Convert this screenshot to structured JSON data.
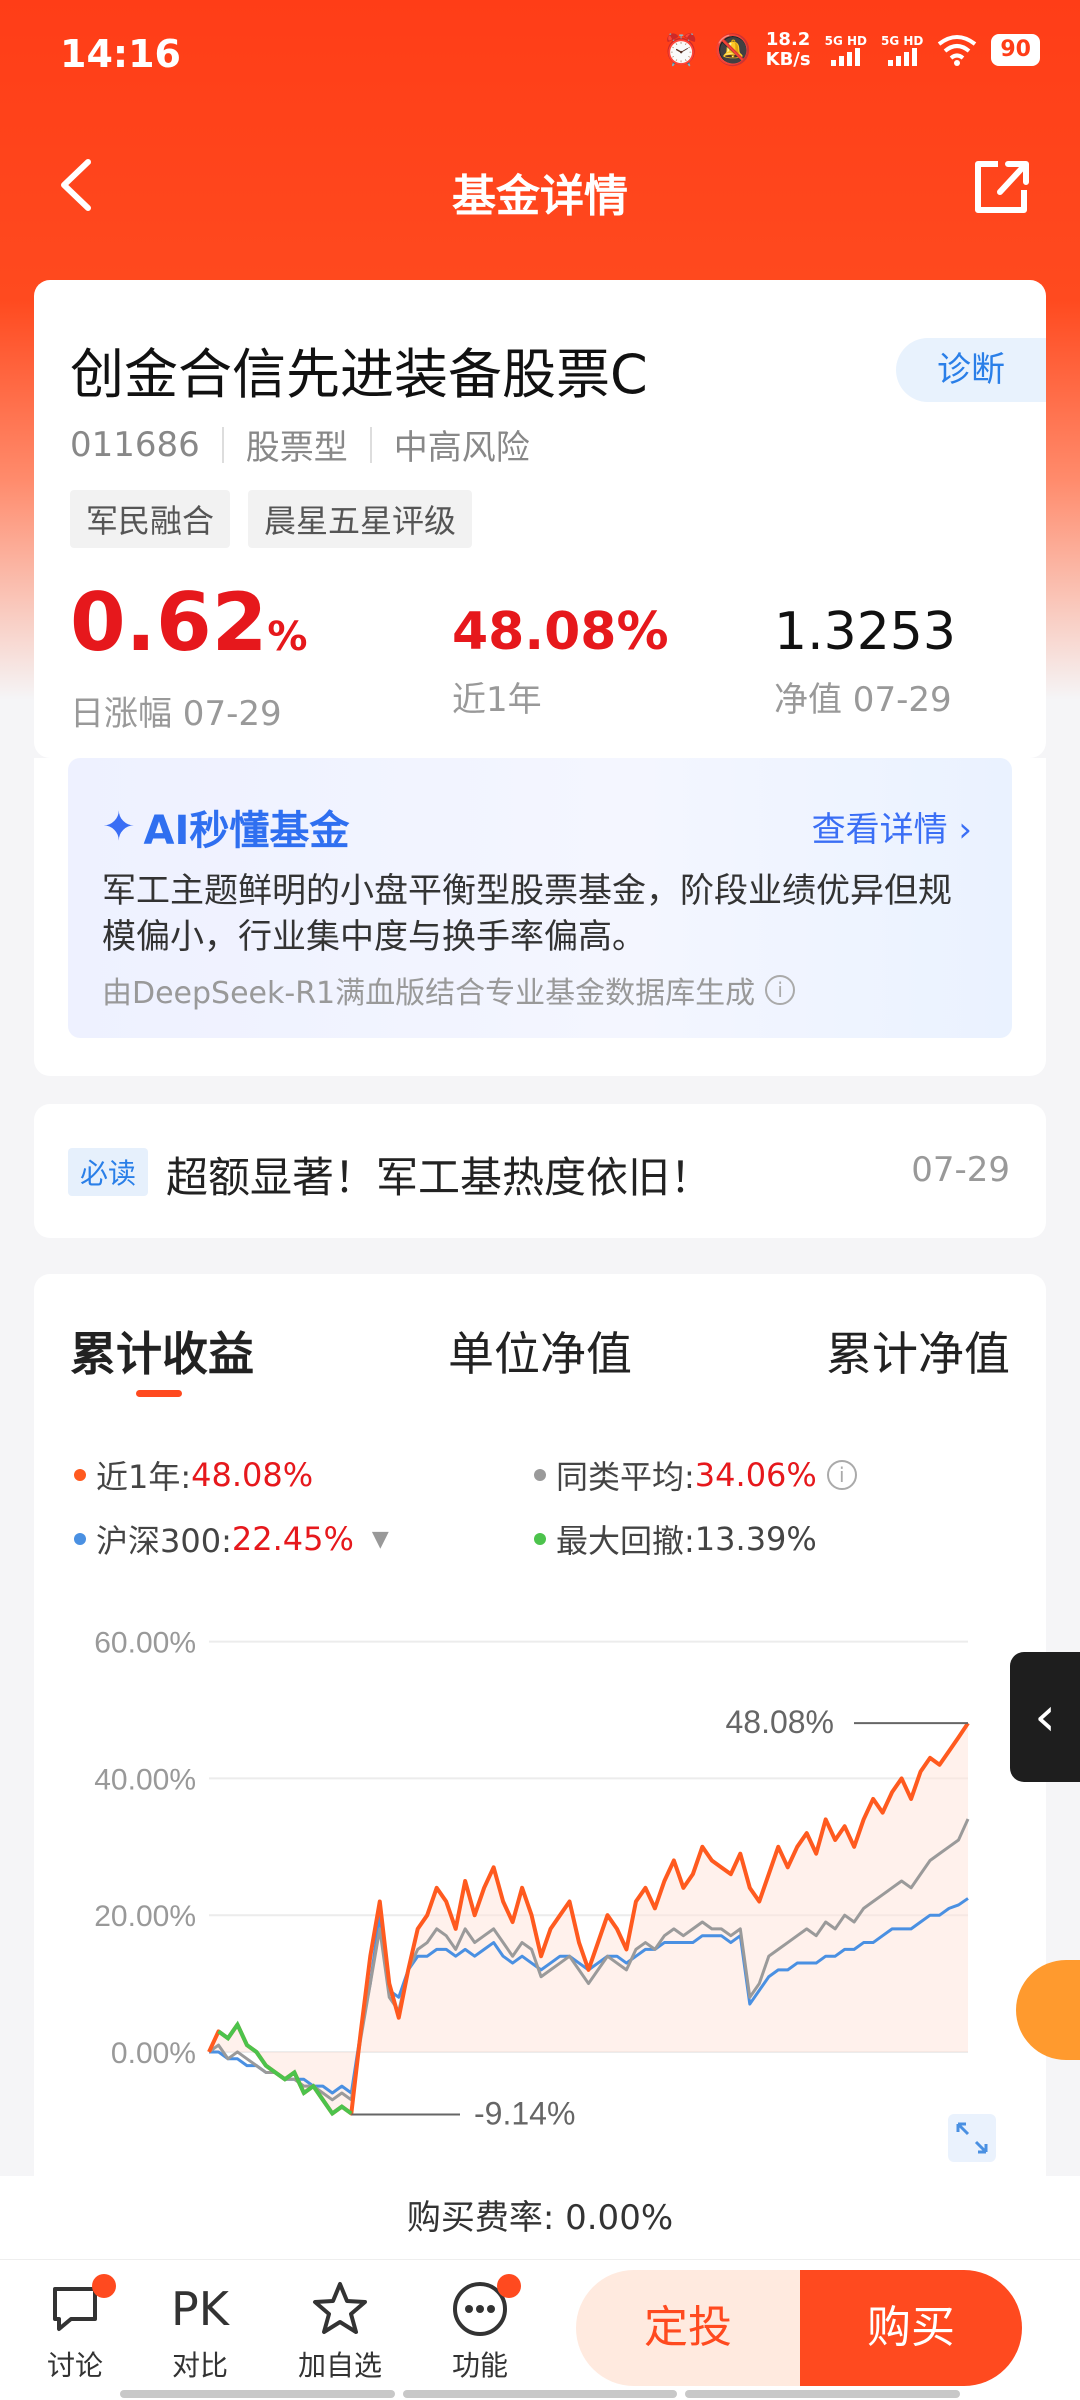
{
  "status_bar": {
    "time": "14:16",
    "net_speed_value": "18.2",
    "net_speed_unit": "KB/s",
    "signal1": "5G HD",
    "signal2": "5G HD",
    "battery": "90"
  },
  "nav": {
    "title": "基金详情"
  },
  "fund": {
    "name": "创金合信先进装备股票C",
    "diagnose_label": "诊断",
    "code": "011686",
    "type": "股票型",
    "risk": "中高风险",
    "tags": [
      "军民融合",
      "晨星五星评级"
    ],
    "daily_change_value": "0.62",
    "daily_change_unit": "%",
    "daily_change_label": "日涨幅 07-29",
    "year_return": "48.08%",
    "year_return_label": "近1年",
    "nav_value": "1.3253",
    "nav_label": "净值 07-29"
  },
  "ai": {
    "title": "AI秒懂基金",
    "more": "查看详情",
    "summary": "军工主题鲜明的小盘平衡型股票基金，阶段业绩优异但规模偏小，行业集中度与换手率偏高。",
    "source": "由DeepSeek-R1满血版结合专业基金数据库生成"
  },
  "news": {
    "tag": "必读",
    "title": "超额显著！军工基热度依旧！",
    "date": "07-29"
  },
  "chart_tabs": [
    "累计收益",
    "单位净值",
    "累计净值"
  ],
  "legend": {
    "fund_label": "近1年:",
    "fund_value": "48.08%",
    "avg_label": "同类平均:",
    "avg_value": "34.06%",
    "hs300_label": "沪深300:",
    "hs300_value": "22.45%",
    "drawdown_label": "最大回撤:",
    "drawdown_value": "13.39%"
  },
  "colors": {
    "fund": "#ff5a1f",
    "average": "#9a9a9a",
    "hs300": "#4a90e2",
    "drawdown": "#4cc34c"
  },
  "chart_data": {
    "type": "line",
    "y_ticks": [
      "60.00%",
      "40.00%",
      "20.00%",
      "0.00%"
    ],
    "ylim": [
      -12,
      62
    ],
    "annotations": {
      "max_label": "48.08%",
      "min_label": "-9.14%"
    },
    "x": [
      0,
      1,
      2,
      3,
      4,
      5,
      6,
      7,
      8,
      9,
      10,
      11,
      12,
      13,
      14,
      15,
      16,
      17,
      18,
      19,
      20,
      21,
      22,
      23,
      24,
      25,
      26,
      27,
      28,
      29,
      30,
      31,
      32,
      33,
      34,
      35,
      36,
      37,
      38,
      39,
      40,
      41,
      42,
      43,
      44,
      45,
      46,
      47,
      48,
      49,
      50,
      51,
      52,
      53,
      54,
      55,
      56,
      57,
      58,
      59,
      60,
      61,
      62,
      63,
      64,
      65,
      66,
      67,
      68,
      69,
      70,
      71,
      72,
      73,
      74,
      75,
      76,
      77,
      78,
      79,
      80
    ],
    "series": [
      {
        "name": "近1年",
        "values": [
          0,
          3,
          2,
          4,
          1,
          0,
          -2,
          -3,
          -4,
          -3,
          -6,
          -5,
          -7,
          -9,
          -8,
          -9,
          3,
          14,
          22,
          10,
          5,
          12,
          18,
          20,
          24,
          22,
          18,
          25,
          20,
          24,
          27,
          22,
          19,
          24,
          20,
          14,
          18,
          20,
          22,
          16,
          12,
          16,
          20,
          18,
          15,
          22,
          24,
          21,
          25,
          28,
          24,
          26,
          30,
          28,
          27,
          26,
          29,
          24,
          22,
          26,
          30,
          27,
          30,
          32,
          29,
          34,
          31,
          33,
          30,
          34,
          37,
          35,
          38,
          40,
          37,
          41,
          43,
          42,
          44,
          46,
          48.08
        ]
      },
      {
        "name": "同类平均",
        "values": [
          0,
          1,
          -1,
          0,
          -1,
          -2,
          -3,
          -3,
          -4,
          -4,
          -5,
          -5,
          -6,
          -7,
          -6,
          -7,
          2,
          10,
          18,
          8,
          6,
          12,
          15,
          16,
          18,
          17,
          15,
          18,
          16,
          17,
          18,
          16,
          14,
          16,
          15,
          11,
          12,
          13,
          14,
          12,
          10,
          12,
          14,
          13,
          12,
          15,
          16,
          15,
          17,
          18,
          17,
          18,
          19,
          18,
          18,
          17,
          18,
          8,
          10,
          14,
          15,
          16,
          17,
          18,
          17,
          19,
          18,
          20,
          19,
          21,
          22,
          23,
          24,
          25,
          24,
          26,
          28,
          29,
          30,
          31,
          34.06
        ]
      },
      {
        "name": "沪深300",
        "values": [
          0,
          0,
          -1,
          -1,
          -2,
          -2,
          -3,
          -3,
          -4,
          -4,
          -4,
          -5,
          -5,
          -6,
          -5,
          -6,
          3,
          10,
          20,
          9,
          8,
          12,
          14,
          14,
          15,
          15,
          14,
          15,
          14,
          15,
          16,
          14,
          13,
          14,
          13,
          12,
          13,
          14,
          14,
          13,
          12,
          13,
          14,
          14,
          13,
          14,
          15,
          15,
          16,
          16,
          16,
          16,
          17,
          17,
          17,
          16,
          17,
          7,
          9,
          11,
          12,
          12,
          13,
          13,
          13,
          14,
          14,
          15,
          15,
          16,
          16,
          17,
          18,
          18,
          18,
          19,
          20,
          20,
          21,
          21.5,
          22.45
        ]
      }
    ],
    "drawdown_segment": {
      "start_index": 1,
      "end_index": 15,
      "from": 4,
      "to": -9.14
    },
    "grid": true
  }
}
